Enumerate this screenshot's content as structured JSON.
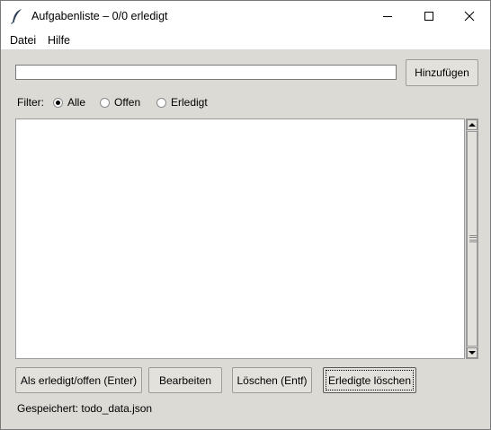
{
  "window": {
    "title": "Aufgabenliste – 0/0 erledigt",
    "icon": "feather-icon",
    "controls": [
      "minimize-icon",
      "maximize-icon",
      "close-icon"
    ]
  },
  "menu": {
    "items": [
      {
        "label": "Datei"
      },
      {
        "label": "Hilfe"
      }
    ]
  },
  "entry": {
    "value": ""
  },
  "add_button": {
    "label": "Hinzufügen"
  },
  "filter": {
    "label": "Filter:",
    "options": [
      {
        "label": "Alle",
        "selected": true
      },
      {
        "label": "Offen",
        "selected": false
      },
      {
        "label": "Erledigt",
        "selected": false
      }
    ]
  },
  "tasks": {
    "items": []
  },
  "actions": {
    "toggle_label": "Als erledigt/offen (Enter)",
    "edit_label": "Bearbeiten",
    "delete_label": "Löschen (Entf)",
    "clear_done_label": "Erledigte löschen"
  },
  "status": {
    "text": "Gespeichert: todo_data.json"
  },
  "colors": {
    "client_bg": "#dcdad5",
    "button_bg": "#e3e1dc",
    "titlebar_bg": "#ffffff"
  }
}
